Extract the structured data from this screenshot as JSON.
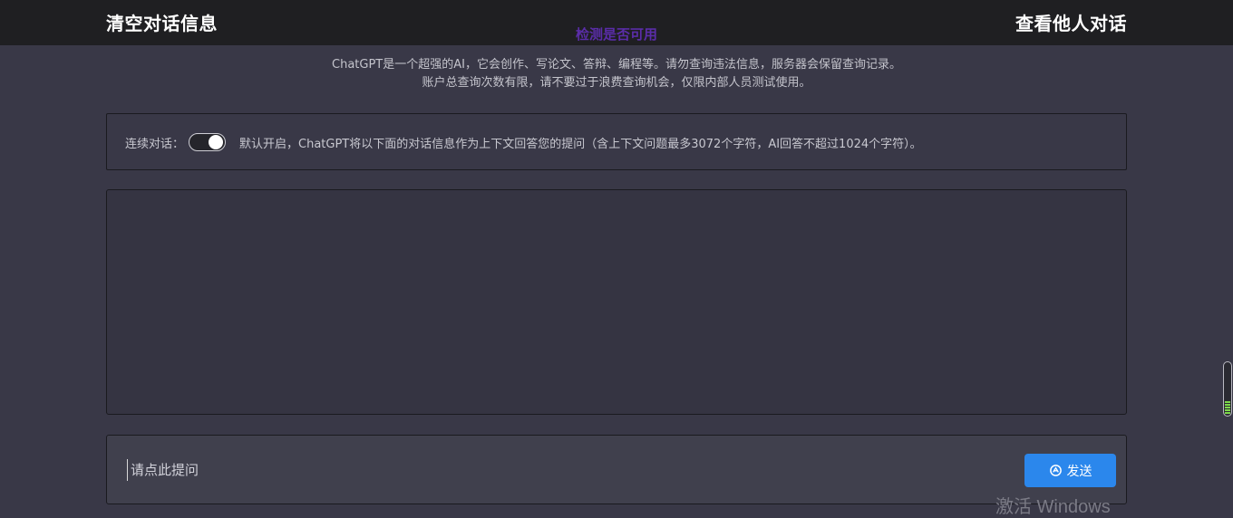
{
  "header": {
    "clear_label": "清空对话信息",
    "view_others_label": "查看他人对话",
    "check_label": "检测是否可用"
  },
  "notice": {
    "line1": "ChatGPT是一个超强的AI，它会创作、写论文、答辩、编程等。请勿查询违法信息，服务器会保留查询记录。",
    "line2": "账户总查询次数有限，请不要过于浪费查询机会，仅限内部人员测试使用。"
  },
  "context": {
    "label": "连续对话：",
    "toggle_on": true,
    "description": "默认开启，ChatGPT将以下面的对话信息作为上下文回答您的提问（含上下文问题最多3072个字符，AI回答不超过1024个字符）。"
  },
  "input": {
    "placeholder": "请点此提问",
    "value": ""
  },
  "send": {
    "label": "发送",
    "icon": "openai-icon"
  },
  "overlay": {
    "watermark": "激活 Windows"
  },
  "colors": {
    "background": "#393847",
    "topbar": "#1f1f22",
    "accent": "#2b87ec",
    "check_link": "#5a2da8"
  }
}
